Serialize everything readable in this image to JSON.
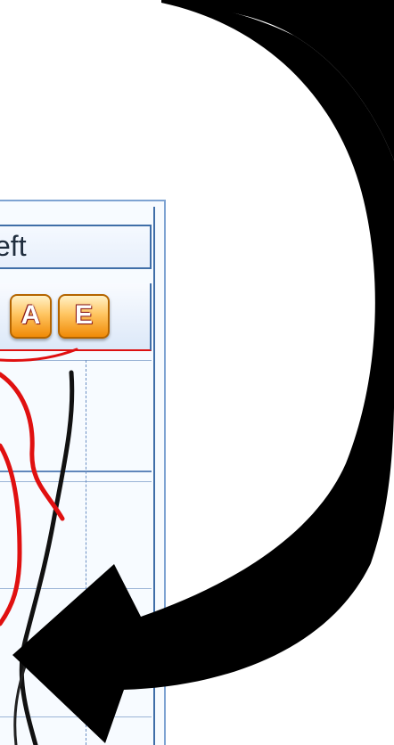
{
  "window": {
    "title_fragment": "eft"
  },
  "toolbar": {
    "buttons": [
      {
        "label": "A"
      },
      {
        "label": "E"
      }
    ]
  },
  "annotation": {
    "arrow": "curved-black-arrow-icon",
    "stroke_colors": {
      "red_trace": "#e01010",
      "black_trace": "#111111",
      "arrow": "#000000"
    }
  }
}
